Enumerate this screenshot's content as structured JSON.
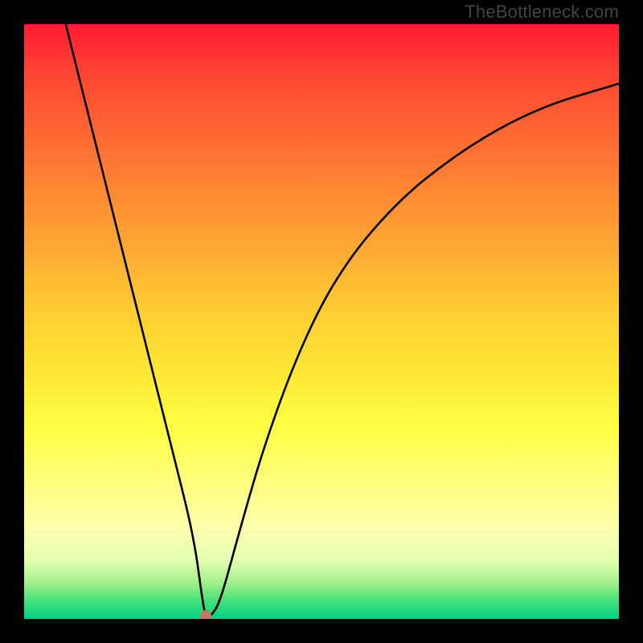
{
  "watermark": "TheBottleneck.com",
  "colors": {
    "page_bg": "#000000",
    "curve_stroke": "#000000",
    "marker_fill": "#c77762"
  },
  "chart_data": {
    "type": "line",
    "title": "",
    "xlabel": "",
    "ylabel": "",
    "xlim": [
      0,
      100
    ],
    "ylim": [
      0,
      100
    ],
    "grid": false,
    "legend": false,
    "series": [
      {
        "name": "bottleneck-curve",
        "x": [
          7,
          10,
          15,
          20,
          25,
          28.5,
          30,
          30.5,
          31.5,
          33,
          36,
          40,
          45,
          50,
          55,
          60,
          65,
          70,
          75,
          80,
          85,
          90,
          95,
          100
        ],
        "y": [
          100,
          88,
          68,
          48,
          28,
          14,
          3,
          0.5,
          0.5,
          3,
          14,
          28,
          42,
          53,
          61,
          67,
          72,
          76,
          79.5,
          82.5,
          85,
          87,
          88.5,
          90
        ]
      }
    ],
    "marker": {
      "x": 30.5,
      "y": 0.5
    },
    "background_gradient": {
      "type": "vertical",
      "stops": [
        {
          "pos": 0,
          "color": "#ff1a33"
        },
        {
          "pos": 8,
          "color": "#ff4433"
        },
        {
          "pos": 18,
          "color": "#ff6633"
        },
        {
          "pos": 28,
          "color": "#ff8833"
        },
        {
          "pos": 38,
          "color": "#ffaa33"
        },
        {
          "pos": 48,
          "color": "#ffcc33"
        },
        {
          "pos": 58,
          "color": "#ffe633"
        },
        {
          "pos": 68,
          "color": "#ffff44"
        },
        {
          "pos": 76,
          "color": "#ffff77"
        },
        {
          "pos": 84,
          "color": "#ffffaa"
        },
        {
          "pos": 90,
          "color": "#e6ffb3"
        },
        {
          "pos": 94,
          "color": "#9fef8a"
        },
        {
          "pos": 97,
          "color": "#44e07a"
        },
        {
          "pos": 100,
          "color": "#00d084"
        }
      ]
    }
  }
}
